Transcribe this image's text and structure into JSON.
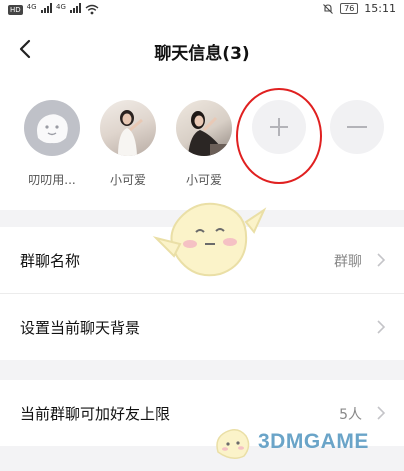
{
  "status_bar": {
    "hd_label": "HD",
    "signal_tag_1": "4G",
    "signal_tag_2": "4G",
    "battery": "76",
    "time": "15:11",
    "icons": [
      "signal-icon",
      "wifi-icon",
      "mute-bell-icon",
      "battery-icon"
    ]
  },
  "header": {
    "title": "聊天信息(3)",
    "back_icon": "chevron-left-icon"
  },
  "members": [
    {
      "name": "叨叨用...",
      "avatar": "ghost-default"
    },
    {
      "name": "小可爱",
      "avatar": "photo"
    },
    {
      "name": "小可爱",
      "avatar": "photo"
    }
  ],
  "actions": {
    "add_icon": "plus-icon",
    "remove_icon": "minus-icon"
  },
  "settings": {
    "group_name": {
      "label": "群聊名称",
      "value": "群聊"
    },
    "chat_background": {
      "label": "设置当前聊天背景"
    },
    "friend_limit": {
      "label": "当前群聊可加好友上限",
      "value": "5人"
    }
  },
  "watermark": {
    "text": "3DMGAME"
  },
  "colors": {
    "highlight_ring": "#e02020",
    "section_gap": "#f3f3f5",
    "action_button": "#f1f1f3",
    "watermark": "#6aa4c8"
  }
}
